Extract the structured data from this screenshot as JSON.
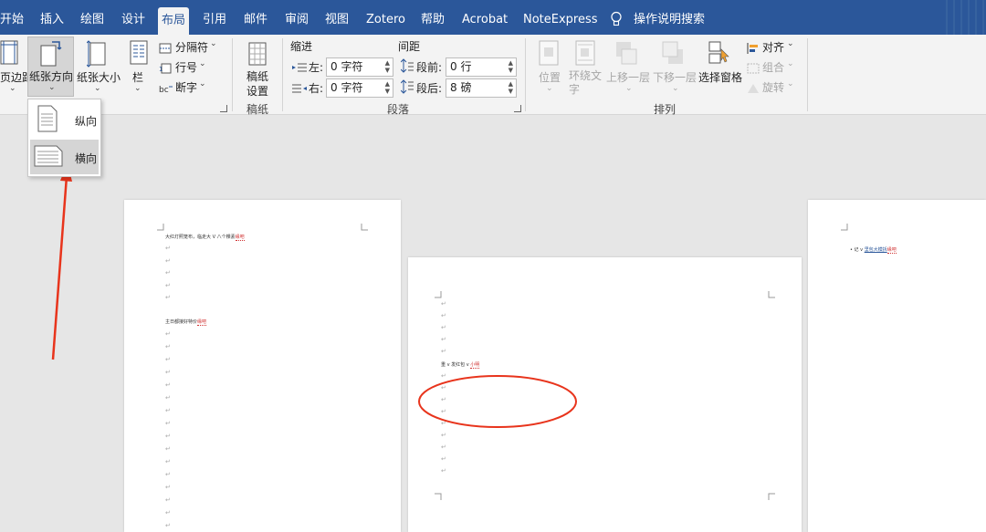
{
  "tabs": [
    "开始",
    "插入",
    "绘图",
    "设计",
    "布局",
    "引用",
    "邮件",
    "审阅",
    "视图",
    "Zotero",
    "帮助",
    "Acrobat",
    "NoteExpress"
  ],
  "active_tab": "布局",
  "tell_me": "操作说明搜索",
  "ribbon": {
    "margins_label": "页边距",
    "orientation_label": "纸张方向",
    "size_label": "纸张大小",
    "columns_label": "栏",
    "breaks_label": "分隔符",
    "line_numbers_label": "行号",
    "hyphenation_label": "断字",
    "manuscript_label": "稿纸\n设置",
    "manuscript_group": "稿纸",
    "indent_title": "缩进",
    "spacing_title": "间距",
    "indent_left_label": "左:",
    "indent_left_value": "0 字符",
    "indent_right_label": "右:",
    "indent_right_value": "0 字符",
    "spacing_before_label": "段前:",
    "spacing_before_value": "0 行",
    "spacing_after_label": "段后:",
    "spacing_after_value": "8 磅",
    "paragraph_group": "段落",
    "position_label": "位置",
    "wrap_text_label": "环绕文\n字",
    "bring_forward_label": "上移一层",
    "send_backward_label": "下移一层",
    "selection_pane_label": "选择窗格",
    "align_label": "对齐",
    "group_label": "组合",
    "rotate_label": "旋转",
    "arrange_group": "排列"
  },
  "orientation_menu": {
    "portrait": "纵向",
    "landscape": "横向"
  },
  "pages": {
    "page1_line1": "大红灯照笼布，临走大 V 八个棵素",
    "page1_sq1": "缘吧",
    "page1_line2": "主日都接好特价",
    "page1_sq2": "缘吧",
    "page2_line1": "重 v 发红包 v ",
    "page2_sq1": "小明",
    "page3_line1": "• 记 v ",
    "page3_link": "里包大模拆",
    "page3_sq1": "缘吧"
  },
  "colors": {
    "tab_bar": "#2b579a",
    "annotation_red": "#e8341c"
  }
}
